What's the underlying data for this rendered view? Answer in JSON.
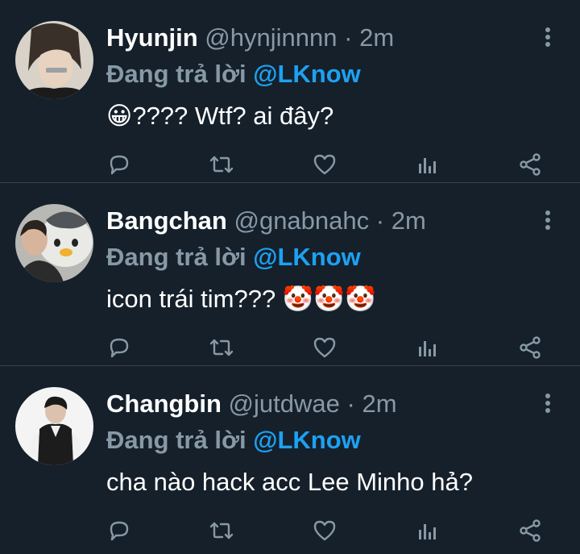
{
  "tweets": [
    {
      "name": "Hyunjin",
      "handle": "@hynjinnnn",
      "separator": "·",
      "time": "2m",
      "reply_label": "Đang trả lời",
      "reply_to": "@LKnow",
      "text_prefix": "😀",
      "text": "???? Wtf? ai đây?",
      "text_suffix": ""
    },
    {
      "name": "Bangchan",
      "handle": "@gnabnahc",
      "separator": "·",
      "time": "2m",
      "reply_label": "Đang trả lời",
      "reply_to": "@LKnow",
      "text_prefix": "",
      "text": "icon trái tim??? ",
      "text_suffix": "🤡🤡🤡"
    },
    {
      "name": "Changbin",
      "handle": "@jutdwae",
      "separator": "·",
      "time": "2m",
      "reply_label": "Đang trả lời",
      "reply_to": "@LKnow",
      "text_prefix": "",
      "text": "cha nào hack acc Lee Minho hả?",
      "text_suffix": ""
    }
  ],
  "icons": {
    "reply": "reply-icon",
    "retweet": "retweet-icon",
    "like": "heart-icon",
    "analytics": "analytics-icon",
    "share": "share-icon",
    "more": "more-vertical-icon"
  },
  "colors": {
    "background": "#15202b",
    "secondary_text": "#8899a6",
    "accent": "#1da1f2",
    "divider": "#38444d"
  }
}
